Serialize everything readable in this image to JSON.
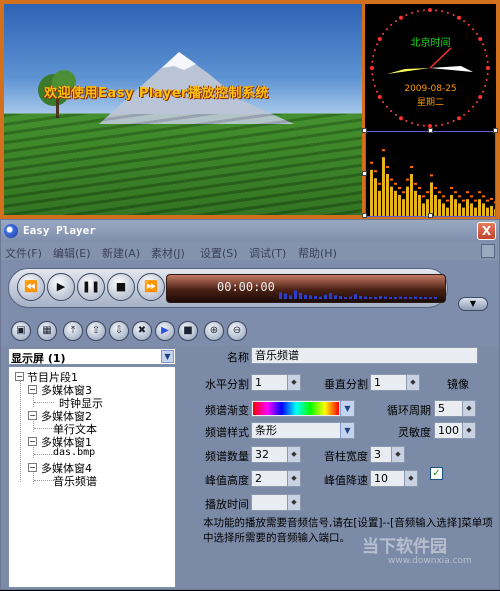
{
  "screen": {
    "welcome_text": "欢迎使用Easy Player播放控制系统",
    "clock": {
      "title": "北京时间",
      "date": "2009-08-25",
      "weekday": "星期二"
    },
    "spectrum_levels": [
      0.55,
      0.45,
      0.3,
      0.7,
      0.5,
      0.35,
      0.3,
      0.25,
      0.2,
      0.35,
      0.5,
      0.3,
      0.25,
      0.15,
      0.2,
      0.4,
      0.25,
      0.2,
      0.15,
      0.1,
      0.25,
      0.2,
      0.15,
      0.1,
      0.2,
      0.15,
      0.1,
      0.2,
      0.15,
      0.1,
      0.12,
      0.08
    ]
  },
  "window": {
    "title": "Easy Player",
    "close_label": "X",
    "menu": [
      "文件(F)",
      "编辑(E)",
      "新建(A)",
      "素材(J)",
      "设置(S)",
      "调试(T)",
      "帮助(H)"
    ],
    "player": {
      "time": "00:00:00"
    }
  },
  "tree": {
    "selector": "显示屏 (1)",
    "nodes": [
      {
        "label": "节目片段1",
        "level": 0,
        "expanded": true
      },
      {
        "label": "多媒体窗3",
        "level": 1,
        "expanded": true
      },
      {
        "label": "时钟显示",
        "level": 2
      },
      {
        "label": "多媒体窗2",
        "level": 1,
        "expanded": true
      },
      {
        "label": "单行文本",
        "level": 2
      },
      {
        "label": "多媒体窗1",
        "level": 1,
        "expanded": true
      },
      {
        "label": "das.bmp",
        "level": 2
      },
      {
        "label": "多媒体窗4",
        "level": 1,
        "expanded": true
      },
      {
        "label": "音乐频谱",
        "level": 2
      }
    ]
  },
  "props": {
    "name_label": "名称",
    "name_value": "音乐频谱",
    "hsplit_label": "水平分割",
    "hsplit_value": "1",
    "vsplit_label": "垂直分割",
    "vsplit_value": "1",
    "mirror_label": "镜像",
    "mirror_checked": true,
    "gradient_label": "频谱渐变",
    "cycle_label": "循环周期",
    "cycle_value": "5",
    "style_label": "频谱样式",
    "style_value": "条形",
    "sensitivity_label": "灵敏度",
    "sensitivity_value": "100",
    "count_label": "频谱数量",
    "count_value": "32",
    "bar_width_label": "音柱宽度",
    "bar_width_value": "3",
    "peak_height_label": "峰值高度",
    "peak_height_value": "2",
    "peak_drop_label": "峰值降速",
    "peak_drop_value": "10",
    "playtime_label": "播放时间",
    "playtime_value": "",
    "note": "本功能的播放需要音频信号,请在[设置]--[音频输入选择]菜单项中选择所需要的音频输入端口。"
  },
  "watermark": {
    "text": "当下软件园",
    "url": "www.downxia.com"
  }
}
